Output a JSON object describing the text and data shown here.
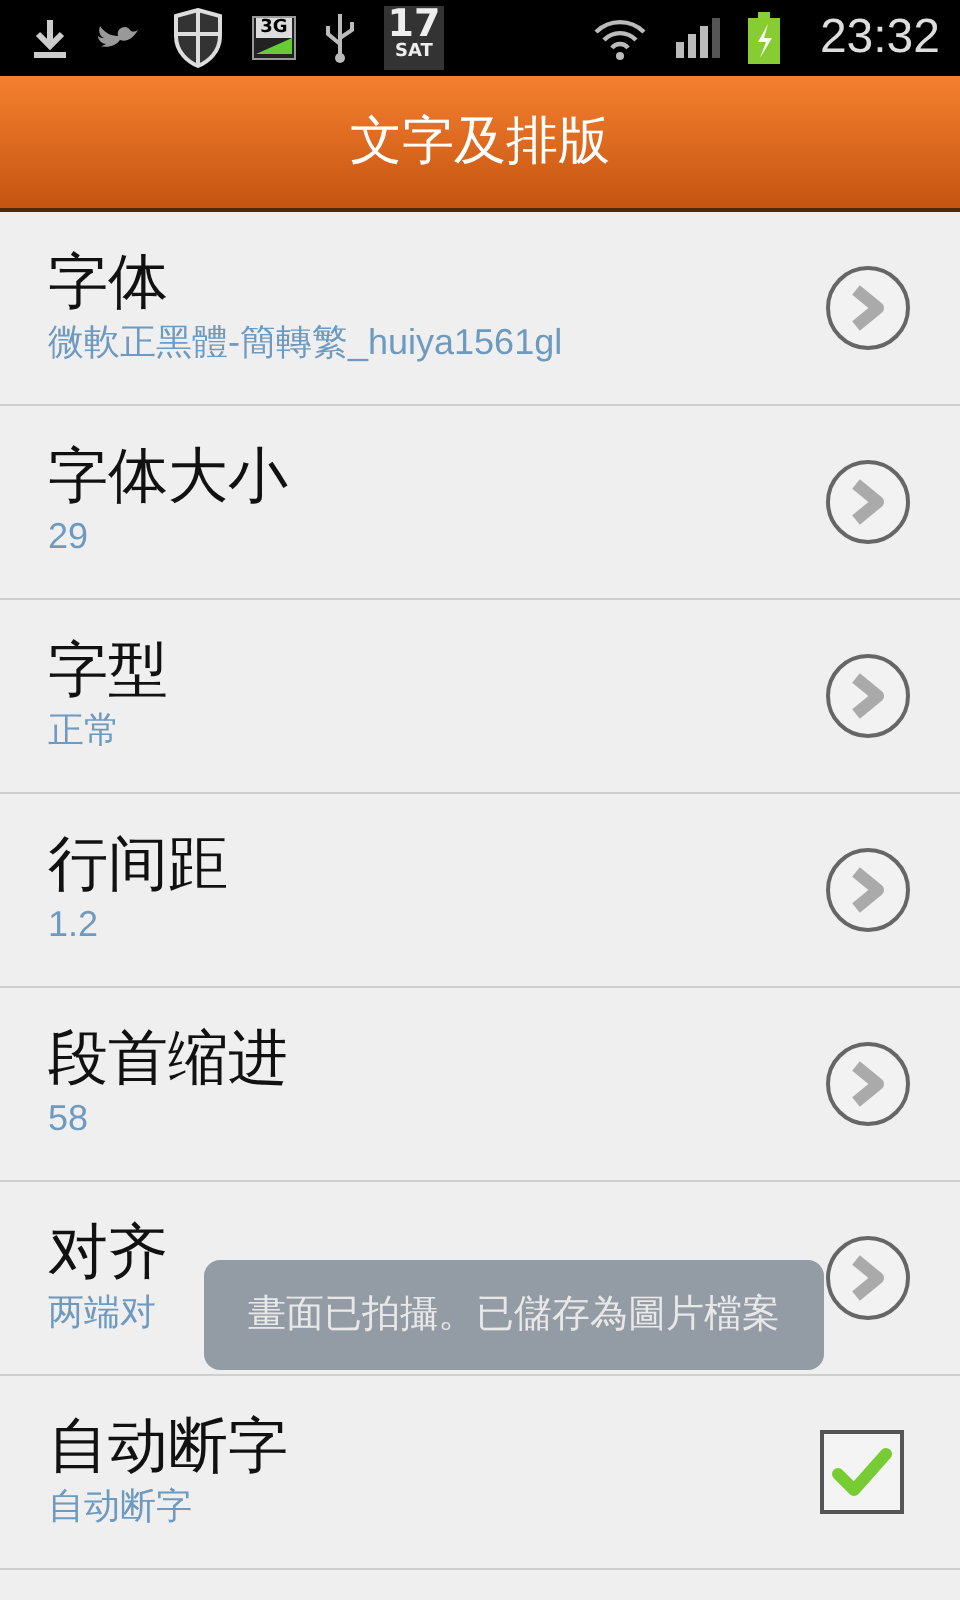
{
  "status_bar": {
    "network_label": "3G",
    "date_day": "17",
    "date_weekday": "SAT",
    "time": "23:32"
  },
  "header": {
    "title": "文字及排版"
  },
  "settings": [
    {
      "kind": "chevron",
      "title": "字体",
      "value": "微軟正黑體-簡轉繁_huiya1561gl"
    },
    {
      "kind": "chevron",
      "title": "字体大小",
      "value": "29"
    },
    {
      "kind": "chevron",
      "title": "字型",
      "value": "正常"
    },
    {
      "kind": "chevron",
      "title": "行间距",
      "value": "1.2"
    },
    {
      "kind": "chevron",
      "title": "段首缩进",
      "value": "58"
    },
    {
      "kind": "chevron",
      "title": "对齐",
      "value": "两端对"
    },
    {
      "kind": "checkbox",
      "title": "自动断字",
      "value": "自动断字",
      "checked": true
    }
  ],
  "toast": {
    "text": "畫面已拍攝。已儲存為圖片檔案"
  }
}
